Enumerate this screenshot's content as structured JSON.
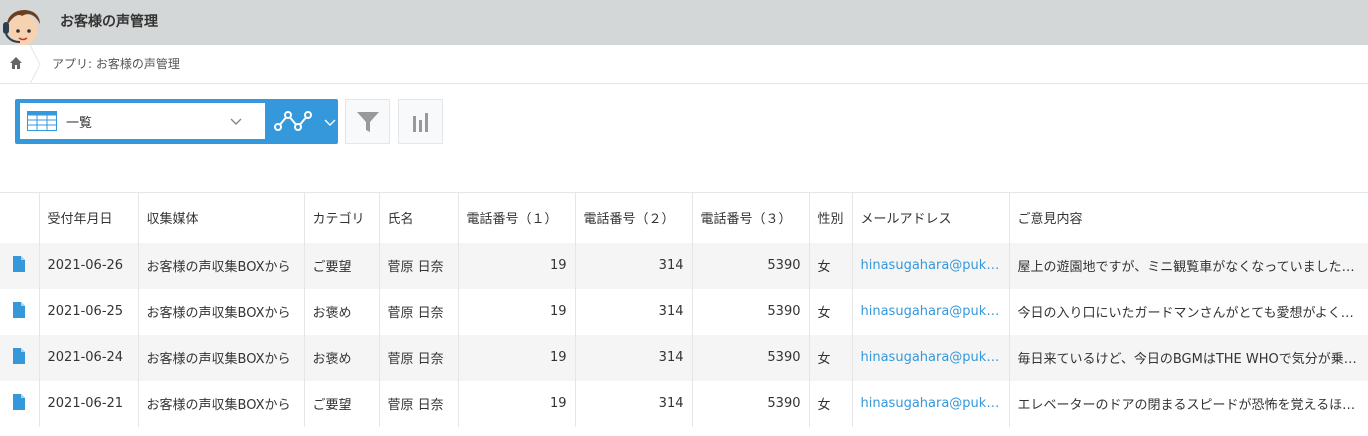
{
  "header": {
    "app_title": "お客様の声管理"
  },
  "breadcrumb": {
    "text": "アプリ: お客様の声管理"
  },
  "toolbar": {
    "view_label": "一覧"
  },
  "table": {
    "columns": [
      "受付年月日",
      "収集媒体",
      "カテゴリ",
      "氏名",
      "電話番号（１）",
      "電話番号（２）",
      "電話番号（３）",
      "性別",
      "メールアドレス",
      "ご意見内容"
    ],
    "rows": [
      {
        "date": "2021-06-26",
        "source": "お客様の声収集BOXから",
        "category": "ご要望",
        "name": "菅原 日奈",
        "tel1": "19",
        "tel2": "314",
        "tel3": "5390",
        "gender": "女",
        "email": "hinasugahara@puk…",
        "opinion": "屋上の遊園地ですが、ミニ観覧車がなくなっていました…"
      },
      {
        "date": "2021-06-25",
        "source": "お客様の声収集BOXから",
        "category": "お褒め",
        "name": "菅原 日奈",
        "tel1": "19",
        "tel2": "314",
        "tel3": "5390",
        "gender": "女",
        "email": "hinasugahara@puk…",
        "opinion": "今日の入り口にいたガードマンさんがとても愛想がよく…"
      },
      {
        "date": "2021-06-24",
        "source": "お客様の声収集BOXから",
        "category": "お褒め",
        "name": "菅原 日奈",
        "tel1": "19",
        "tel2": "314",
        "tel3": "5390",
        "gender": "女",
        "email": "hinasugahara@puk…",
        "opinion": "毎日来ているけど、今日のBGMはTHE WHOで気分が乗…"
      },
      {
        "date": "2021-06-21",
        "source": "お客様の声収集BOXから",
        "category": "ご要望",
        "name": "菅原 日奈",
        "tel1": "19",
        "tel2": "314",
        "tel3": "5390",
        "gender": "女",
        "email": "hinasugahara@puk…",
        "opinion": "エレベーターのドアの閉まるスピードが恐怖を覚えるほ…"
      }
    ]
  }
}
